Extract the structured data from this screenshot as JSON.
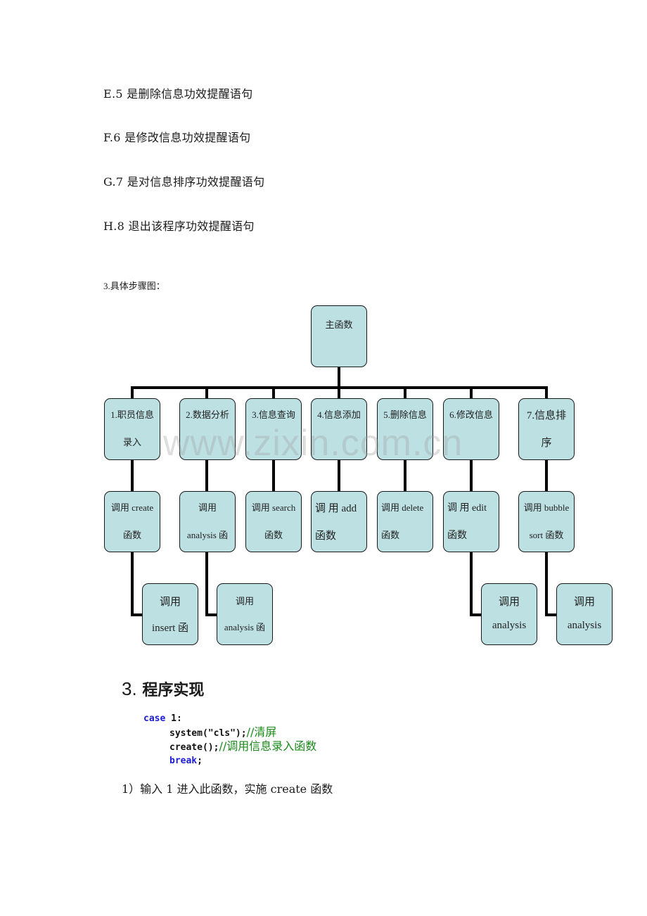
{
  "paragraphs": [
    "E.5 是删除信息功效提醒语句",
    "F.6 是修改信息功效提醒语句",
    "G.7 是对信息排序功效提醒语句",
    "H.8 退出该程序功效提醒语句"
  ],
  "section_caption": "3.具体步骤图：",
  "flowchart": {
    "root": {
      "label": "主函数"
    },
    "modules": [
      {
        "line1": "1.职员信息",
        "line2": "录入",
        "call_line1": "调用 create",
        "call_line2": "函数"
      },
      {
        "line1": "2.数据分析",
        "line2": "",
        "call_line1": "调用",
        "call_line2": "analysis 函"
      },
      {
        "line1": "3.信息查询",
        "line2": "",
        "call_line1": "调用 search",
        "call_line2": "函数"
      },
      {
        "line1": "4.信息添加",
        "line2": "",
        "call_line1": "调 用  add",
        "call_line2": "函数"
      },
      {
        "line1": "5.删除信息",
        "line2": "",
        "call_line1": "调用  delete",
        "call_line2": "函数"
      },
      {
        "line1": "6.修改信息",
        "line2": "",
        "call_line1": "调 用   edit",
        "call_line2": "函数"
      },
      {
        "line1": "7.信息排",
        "line2": "序",
        "call_line1": "调用 bubble",
        "call_line2": "sort 函数"
      }
    ],
    "sub_calls": [
      {
        "line1": "调用",
        "line2": "insert 函"
      },
      {
        "line1": "调用",
        "line2": "analysis 函"
      },
      {
        "line1": "调用",
        "line2": "analysis"
      },
      {
        "line1": "调用",
        "line2": "analysis"
      }
    ]
  },
  "watermark": "www.zixin.com.cn",
  "heading": {
    "number": "3.",
    "title": "程序实现"
  },
  "code": {
    "line1_kw": "case",
    "line1_rest": " 1:",
    "line2_code": "system(\"cls\");",
    "line2_comment": "//清屏",
    "line3_code": "create();",
    "line3_comment": "//调用信息录入函数",
    "line4_kw": "break",
    "line4_rest": ";"
  },
  "note": "1）输入 1 进入此函数，实施 create 函数"
}
